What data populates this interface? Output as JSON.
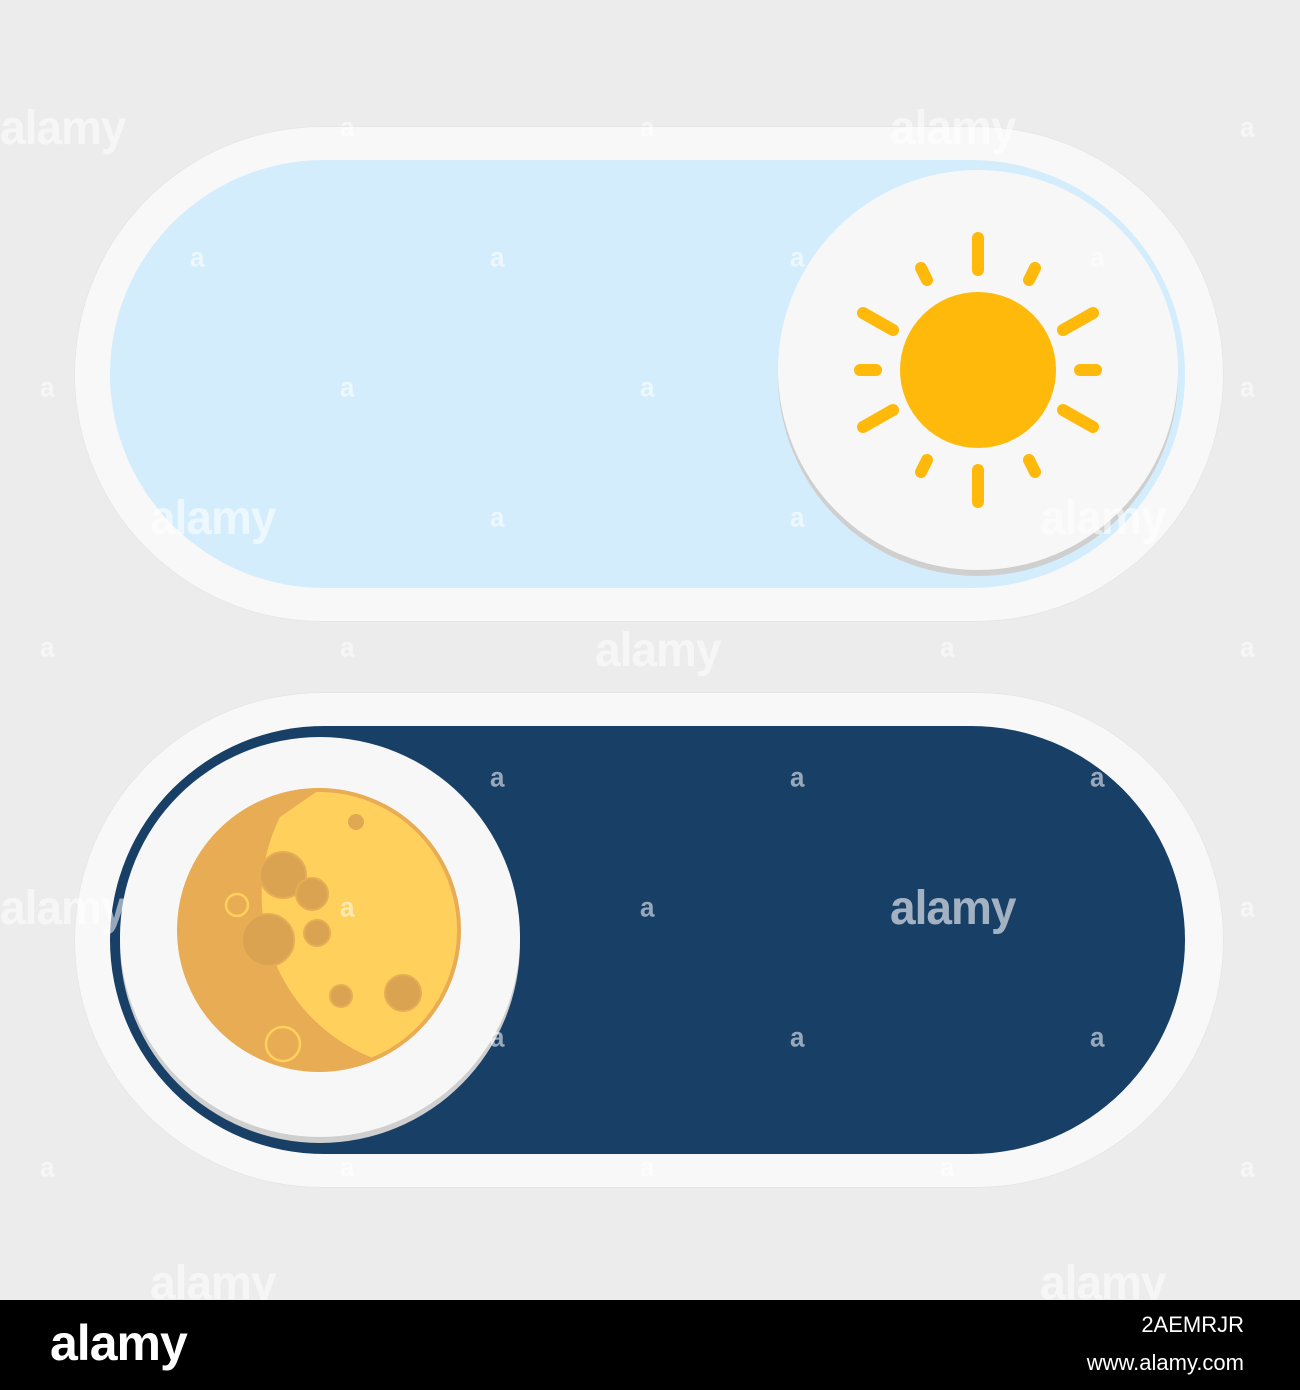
{
  "toggles": [
    {
      "name": "day",
      "state": "on",
      "knob_position": "right",
      "icon": "sun-icon",
      "track_color": "#d4edfc",
      "icon_color": "#ffb90b"
    },
    {
      "name": "night",
      "state": "off",
      "knob_position": "left",
      "icon": "moon-icon",
      "track_color": "#183f66",
      "icon_color": "#ffd15c"
    }
  ],
  "frame_color": "#f8f8f8",
  "background_color": "#ececec",
  "watermark": {
    "word": "alamy",
    "letter": "a"
  },
  "stock_bar": {
    "logo": "alamy",
    "image_id": "2AEMRJR",
    "url": "www.alamy.com"
  }
}
